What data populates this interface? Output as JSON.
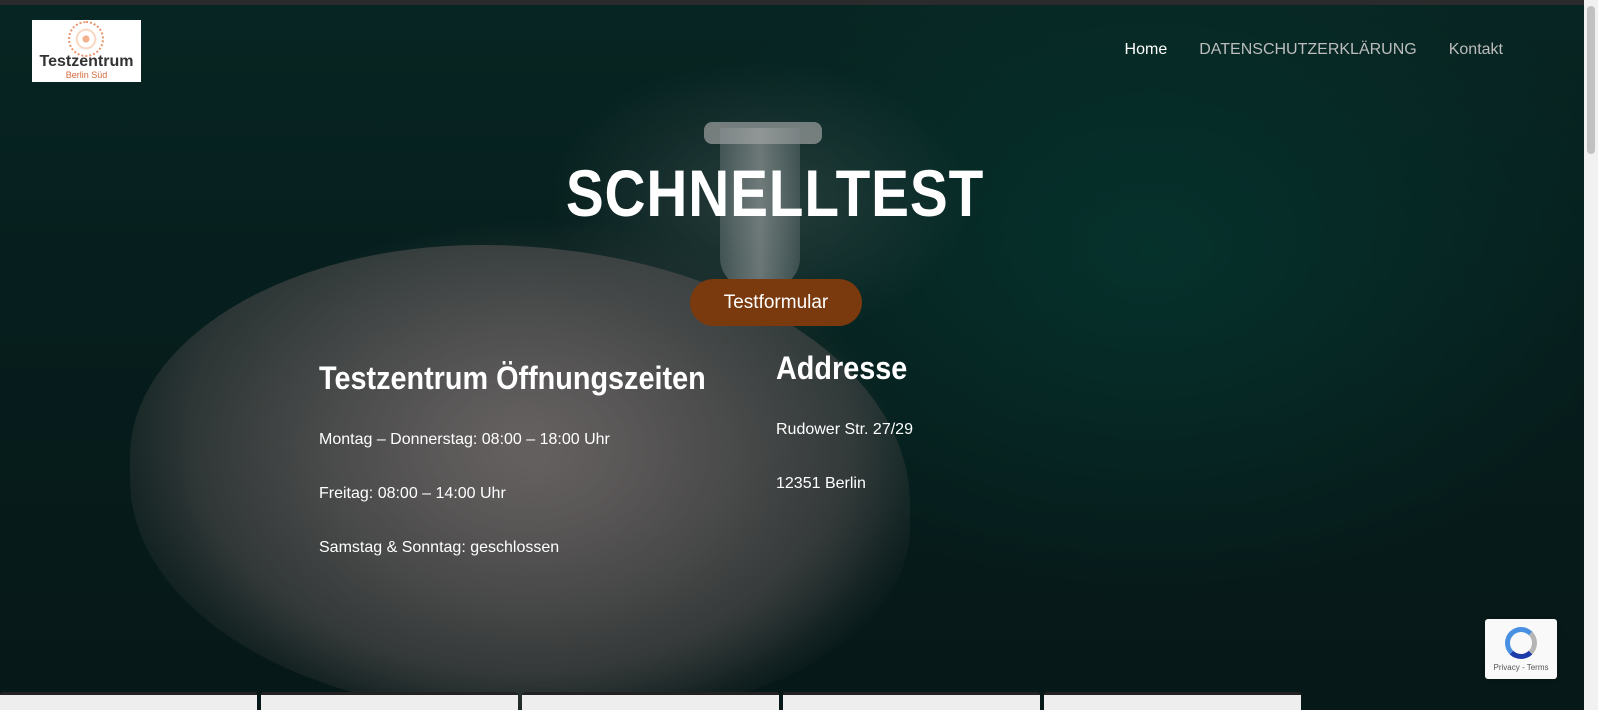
{
  "logo": {
    "name": "Testzentrum",
    "sub": "Berlin Süd"
  },
  "nav": [
    {
      "label": "Home",
      "active": true
    },
    {
      "label": "DATENSCHUTZERKLÄRUNG",
      "active": false
    },
    {
      "label": "Kontakt",
      "active": false
    }
  ],
  "hero": {
    "title": "SCHNELLTEST",
    "cta_label": "Testformular"
  },
  "hours": {
    "heading": "Testzentrum Öffnungszeiten",
    "lines": [
      "Montag – Donnerstag: 08:00 – 18:00 Uhr",
      "Freitag: 08:00 – 14:00 Uhr",
      "Samstag & Sonntag: geschlossen"
    ]
  },
  "address": {
    "heading": "Addresse",
    "lines": [
      "Rudower Str. 27/29",
      "12351 Berlin"
    ]
  },
  "recaptcha": {
    "links": "Privacy - Terms"
  },
  "colors": {
    "cta": "#7a3a0e",
    "logo_accent": "#d4693c"
  }
}
